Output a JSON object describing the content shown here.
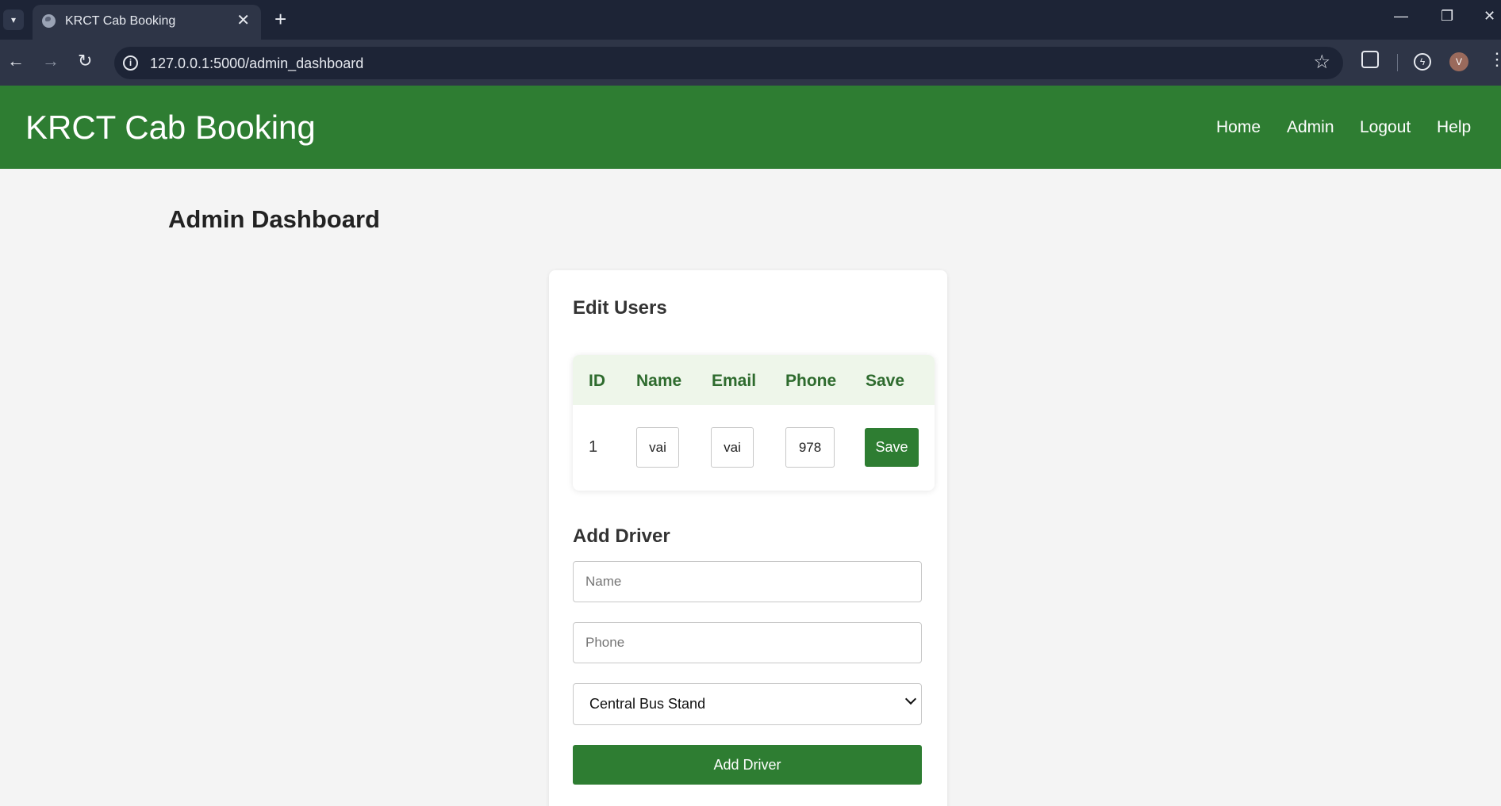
{
  "browser": {
    "tab_title": "KRCT Cab Booking",
    "tab_close": "✕",
    "new_tab": "+",
    "url": "127.0.0.1:5000/admin_dashboard",
    "profile_initial": "V",
    "icons": [
      "tab-search-icon",
      "globe-icon",
      "close-icon",
      "plus-icon",
      "back-arrow-icon",
      "forward-arrow-icon",
      "reload-icon",
      "info-icon",
      "star-icon",
      "extensions-icon",
      "performance-icon",
      "menu-kebab-icon",
      "minimize-icon",
      "restore-icon",
      "window-close-icon"
    ]
  },
  "header": {
    "brand": "KRCT Cab Booking",
    "nav": [
      "Home",
      "Admin",
      "Logout",
      "Help"
    ],
    "bg_color": "#2e7d32"
  },
  "main": {
    "title": "Admin Dashboard",
    "edit_users": {
      "title": "Edit Users",
      "columns": [
        "ID",
        "Name",
        "Email",
        "Phone",
        "Save"
      ],
      "rows": [
        {
          "id": "1",
          "name": "vai",
          "email": "vai",
          "phone": "978",
          "save_label": "Save"
        }
      ]
    },
    "add_driver": {
      "title": "Add Driver",
      "name_placeholder": "Name",
      "phone_placeholder": "Phone",
      "location_selected": "Central Bus Stand",
      "submit_label": "Add Driver"
    }
  },
  "colors": {
    "accent": "#2e7d32",
    "table_header_bg": "#eef6ea",
    "table_header_text": "#2e6b2e",
    "page_bg": "#f4f4f4"
  }
}
